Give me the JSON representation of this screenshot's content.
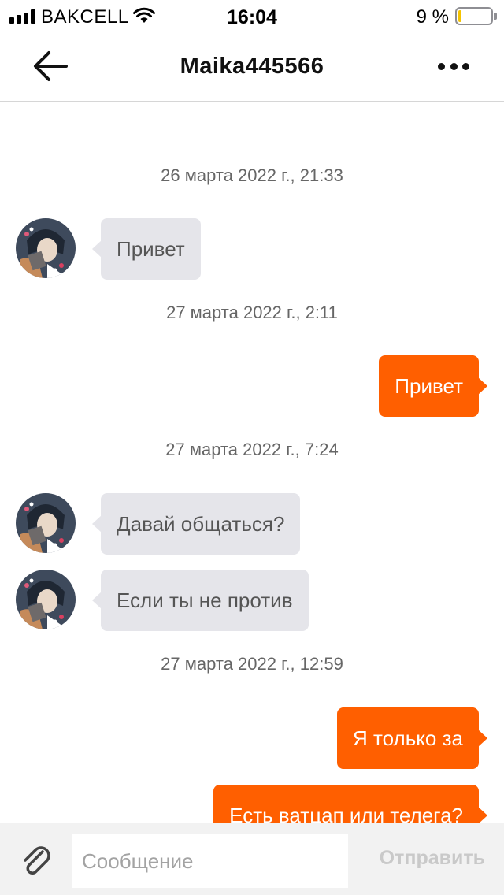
{
  "status_bar": {
    "carrier": "BAKCELL",
    "time": "16:04",
    "battery_percent": "9 %",
    "battery_level": 0.09,
    "battery_color": "#f5c400"
  },
  "header": {
    "title": "Maika445566",
    "back_icon": "arrow-left-icon",
    "more_icon": "more-horizontal-icon"
  },
  "chat": {
    "timestamps": [
      "26 марта 2022 г., 21:33",
      "27 марта 2022 г., 2:11",
      "27 марта 2022 г., 7:24",
      "27 марта 2022 г., 12:59"
    ],
    "messages": [
      {
        "from": "incoming",
        "text": "Привет"
      },
      {
        "from": "outgoing",
        "text": "Привет"
      },
      {
        "from": "incoming",
        "text": "Давай общаться?"
      },
      {
        "from": "incoming",
        "text": "Если ты не против"
      },
      {
        "from": "outgoing",
        "text": "Я только за"
      },
      {
        "from": "outgoing",
        "text": "Есть ватцап или телега?"
      }
    ],
    "outgoing_color": "#ff5f00",
    "incoming_color": "#e5e5ea"
  },
  "input_bar": {
    "attach_icon": "paperclip-icon",
    "placeholder": "Сообщение",
    "value": "",
    "send_label": "Отправить"
  }
}
